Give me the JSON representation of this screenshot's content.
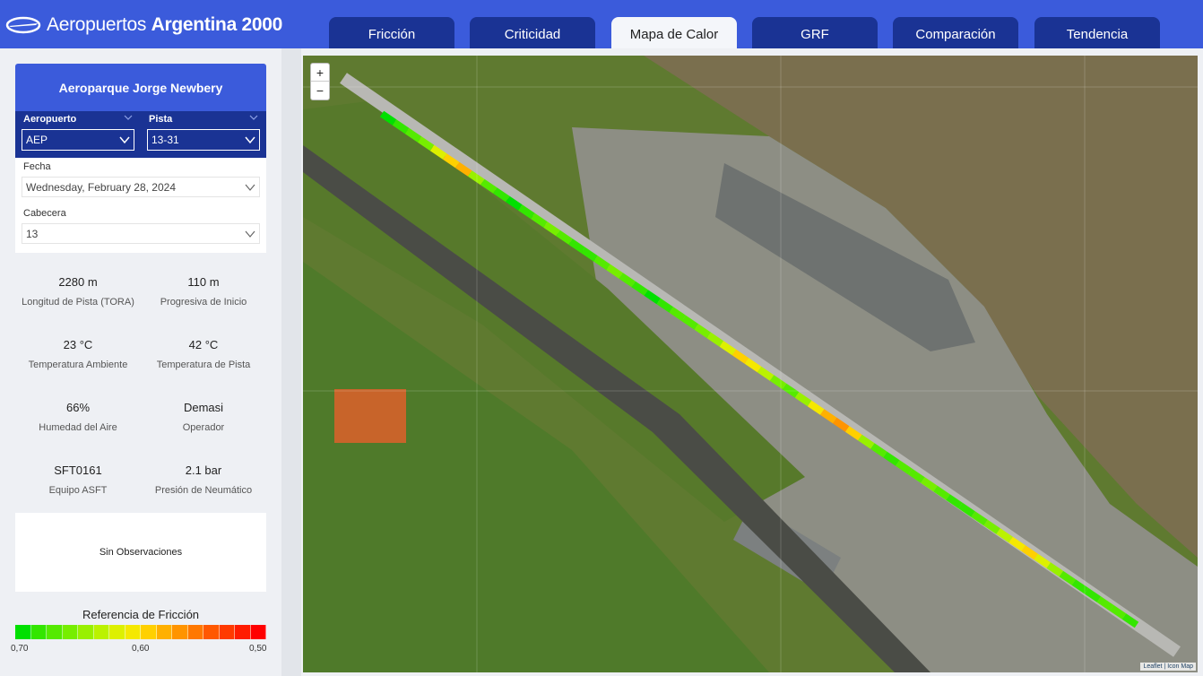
{
  "header": {
    "logo_light": "Aeropuertos ",
    "logo_bold": "Argentina 2000",
    "tabs": [
      {
        "label": "Fricción",
        "active": false
      },
      {
        "label": "Criticidad",
        "active": false
      },
      {
        "label": "Mapa de Calor",
        "active": true
      },
      {
        "label": "GRF",
        "active": false
      },
      {
        "label": "Comparación",
        "active": false
      },
      {
        "label": "Tendencia",
        "active": false
      }
    ]
  },
  "sidebar": {
    "airport_title": "Aeroparque Jorge Newbery",
    "aeropuerto_label": "Aeropuerto",
    "aeropuerto_value": "AEP",
    "pista_label": "Pista",
    "pista_value": "13-31",
    "fecha_label": "Fecha",
    "fecha_value": "Wednesday, February 28, 2024",
    "cabecera_label": "Cabecera",
    "cabecera_value": "13",
    "stats": [
      {
        "value": "2280 m",
        "label": "Longitud de Pista (TORA)"
      },
      {
        "value": "110 m",
        "label": "Progresiva de Inicio"
      },
      {
        "value": "23 °C",
        "label": "Temperatura Ambiente"
      },
      {
        "value": "42 °C",
        "label": "Temperatura de Pista"
      },
      {
        "value": "66%",
        "label": "Humedad del Aire"
      },
      {
        "value": "Demasi",
        "label": "Operador"
      },
      {
        "value": "SFT0161",
        "label": "Equipo ASFT"
      },
      {
        "value": "2.1 bar",
        "label": "Presión de Neumático"
      }
    ],
    "observaciones": "Sin Observaciones",
    "legend_title": "Referencia de Fricción",
    "legend_ticks": [
      "0,70",
      "0,60",
      "0,50"
    ],
    "legend_colors": [
      "#00e000",
      "#33e600",
      "#55ea00",
      "#77ee00",
      "#99f000",
      "#bbf200",
      "#ddf000",
      "#f5e800",
      "#ffd000",
      "#ffb000",
      "#ff9400",
      "#ff7800",
      "#ff5800",
      "#ff3a00",
      "#ff1c00",
      "#ff0000"
    ]
  },
  "map": {
    "zoom_in": "+",
    "zoom_out": "−",
    "attribution": "Leaflet | Icon Map",
    "colors": {
      "water": "#7a6f4e",
      "land": "#5f7a30",
      "runway": "#b8b8b4",
      "apron": "#9a9a94"
    }
  }
}
